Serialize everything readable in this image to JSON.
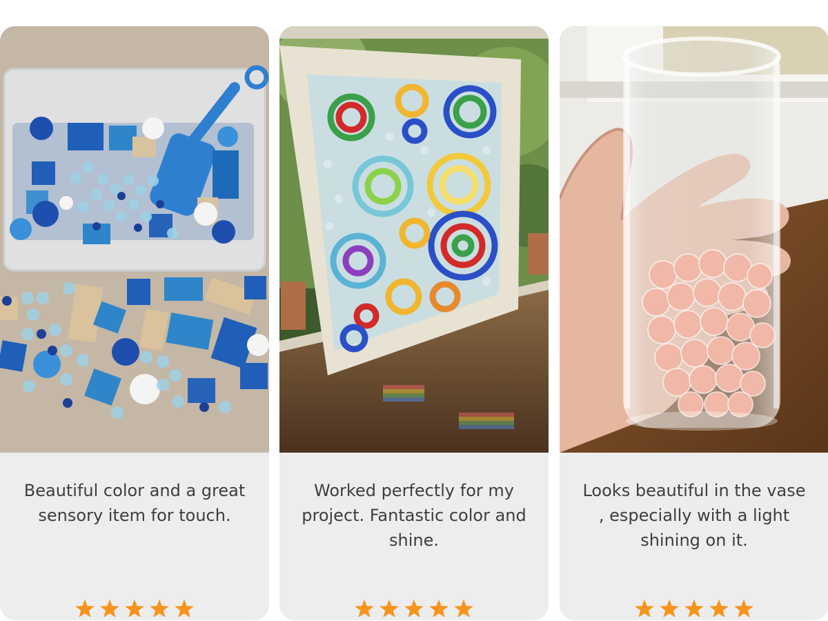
{
  "colors": {
    "card_background": "#ededed",
    "text": "#3e3e3e",
    "star": "#f7941d"
  },
  "reviews": [
    {
      "text": "Beautiful color and a great sensory item for touch.",
      "rating": 5,
      "photo_icon": "sensory-bin-photo"
    },
    {
      "text": "Worked perfectly for my project. Fantastic color and shine.",
      "rating": 5,
      "photo_icon": "suncatcher-window-photo"
    },
    {
      "text": "Looks beautiful in the vase , especially with a light shining on it.",
      "rating": 5,
      "photo_icon": "glass-vase-photo"
    }
  ]
}
